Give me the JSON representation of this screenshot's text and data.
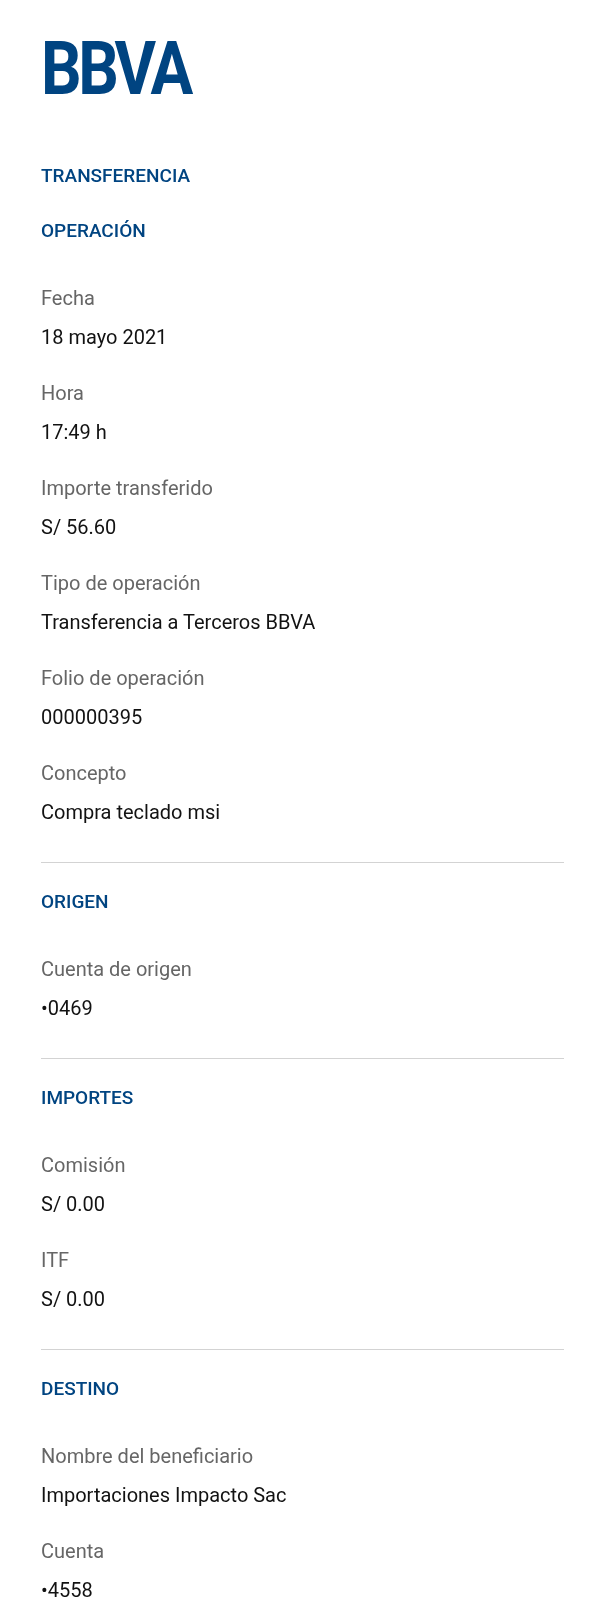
{
  "logo": "BBVA",
  "title": "TRANSFERENCIA",
  "sections": [
    {
      "heading": "OPERACIÓN",
      "fields": [
        {
          "label": "Fecha",
          "value": "18 mayo 2021"
        },
        {
          "label": "Hora",
          "value": "17:49 h"
        },
        {
          "label": "Importe transferido",
          "value": "S/ 56.60"
        },
        {
          "label": "Tipo de operación",
          "value": "Transferencia a Terceros BBVA"
        },
        {
          "label": "Folio de operación",
          "value": "000000395"
        },
        {
          "label": "Concepto",
          "value": "Compra teclado msi"
        }
      ]
    },
    {
      "heading": "ORIGEN",
      "fields": [
        {
          "label": "Cuenta de origen",
          "value": "•0469"
        }
      ]
    },
    {
      "heading": "IMPORTES",
      "fields": [
        {
          "label": "Comisión",
          "value": "S/ 0.00"
        },
        {
          "label": "ITF",
          "value": "S/ 0.00"
        }
      ]
    },
    {
      "heading": "DESTINO",
      "fields": [
        {
          "label": "Nombre del beneficiario",
          "value": "Importaciones Impacto Sac"
        },
        {
          "label": "Cuenta",
          "value": "•4558"
        }
      ]
    }
  ]
}
